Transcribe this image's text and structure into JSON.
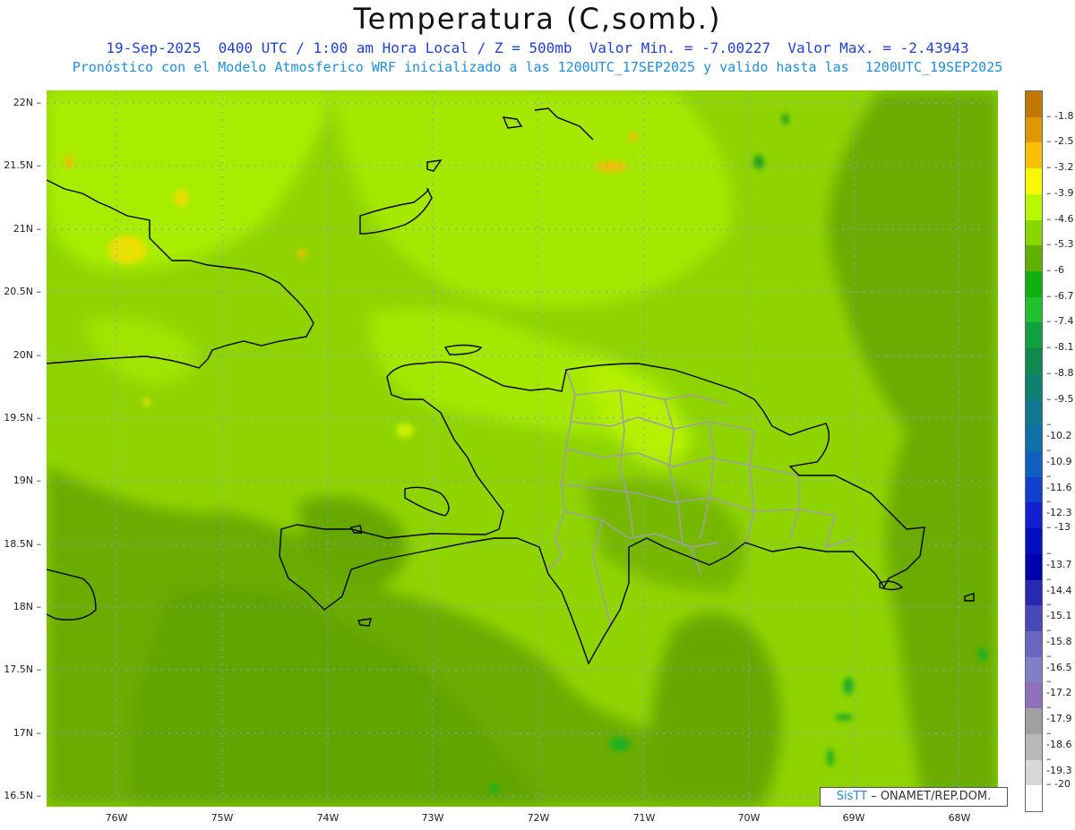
{
  "header": {
    "title": "Temperatura (C,somb.)",
    "line1": "19-Sep-2025  0400 UTC / 1:00 am Hora Local / Z = 500mb  Valor Min. = -7.00227  Valor Max. = -2.43943",
    "line2": "Pronóstico con el Modelo Atmosferico WRF inicializado a las 1200UTC_17SEP2025 y valido hasta las  1200UTC_19SEP2025"
  },
  "axes": {
    "lat_labels": [
      "22N",
      "21.5N",
      "21N",
      "20.5N",
      "20N",
      "19.5N",
      "19N",
      "18.5N",
      "18N",
      "17.5N",
      "17N",
      "16.5N"
    ],
    "lon_labels": [
      "76W",
      "75W",
      "74W",
      "73W",
      "72W",
      "71W",
      "70W",
      "69W",
      "68W"
    ]
  },
  "colorbar": {
    "labels": [
      "-1.8",
      "-2.5",
      "-3.2",
      "-3.9",
      "-4.6",
      "-5.3",
      "-6",
      "-6.7",
      "-7.4",
      "-8.1",
      "-8.8",
      "-9.5",
      "-10.2",
      "-10.9",
      "-11.6",
      "-12.3",
      "-13",
      "-13.7",
      "-14.4",
      "-15.1",
      "-15.8",
      "-16.5",
      "-17.2",
      "-17.9",
      "-18.6",
      "-19.3",
      "-20"
    ],
    "colors": [
      "#c07800",
      "#e09800",
      "#f8c000",
      "#f8f800",
      "#b8f800",
      "#88d800",
      "#60b000",
      "#10b010",
      "#20c030",
      "#10a040",
      "#108850",
      "#108070",
      "#107890",
      "#1070a8",
      "#1060c0",
      "#1040d0",
      "#1020d0",
      "#0010c0",
      "#0000b0",
      "#2828b0",
      "#4848b8",
      "#6868c0",
      "#8080c8",
      "#9070b8",
      "#a0a0a0",
      "#b8b8b8",
      "#d8d8d8"
    ],
    "bottom_color": "#ffffff"
  },
  "credit": {
    "brand": "SisTT",
    "org": " – ONAMET/REP.DOM."
  }
}
